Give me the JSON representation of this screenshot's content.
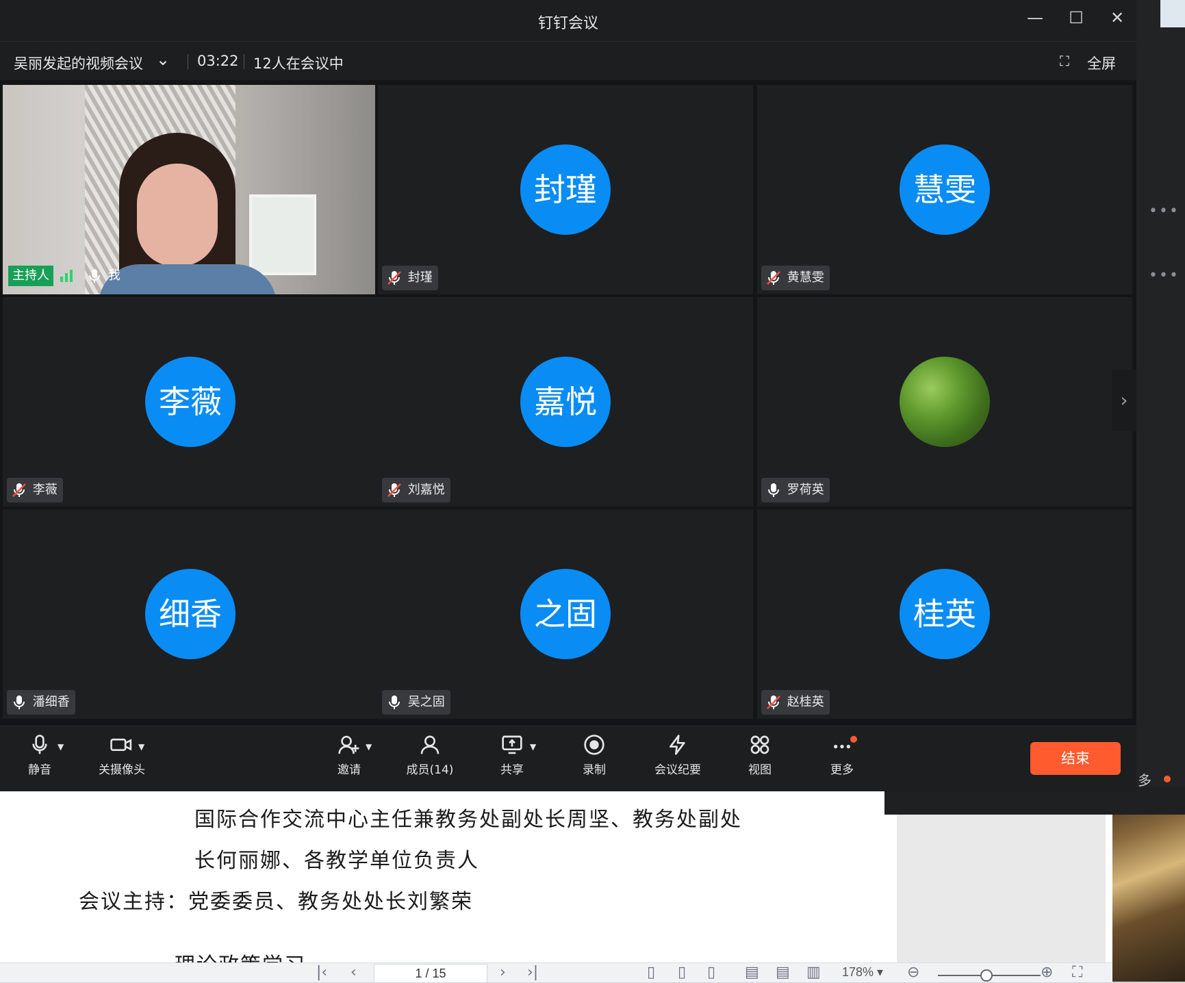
{
  "window": {
    "title": "钉钉会议",
    "minimize": "—",
    "maximize": "☐",
    "close": "✕"
  },
  "info": {
    "meeting_name": "吴丽发起的视频会议",
    "duration": "03:22",
    "participants_in_meeting": "12人在会议中",
    "fullscreen_label": "全屏"
  },
  "host": {
    "role_tag": "主持人",
    "name": "我"
  },
  "tiles": [
    {
      "avatar": "封瑾",
      "name": "封瑾",
      "muted": true
    },
    {
      "avatar": "慧雯",
      "name": "黄慧雯",
      "muted": true
    },
    {
      "avatar": "李薇",
      "name": "李薇",
      "muted": true
    },
    {
      "avatar": "嘉悦",
      "name": "刘嘉悦",
      "muted": true
    },
    {
      "avatar": "",
      "name": "罗荷英",
      "muted": false
    },
    {
      "avatar": "细香",
      "name": "潘细香",
      "muted": false
    },
    {
      "avatar": "之固",
      "name": "吴之固",
      "muted": false
    },
    {
      "avatar": "桂英",
      "name": "赵桂英",
      "muted": true
    }
  ],
  "toolbar": {
    "mute": "静音",
    "camera_off": "关摄像头",
    "invite": "邀请",
    "members": "成员(14)",
    "share": "共享",
    "record": "录制",
    "minutes": "会议纪要",
    "view": "视图",
    "more": "更多",
    "end": "结束"
  },
  "document": {
    "lines": [
      "国际合作交流中心主任兼教务处副处长周坚、教务处副处",
      "长何丽娜、各教学单位负责人",
      "会议主持：党委委员、教务处处长刘繁荣",
      "理论政策学习"
    ],
    "page_indicator": "1 / 15",
    "zoom": "178%"
  },
  "side": {
    "more_label": "多"
  }
}
